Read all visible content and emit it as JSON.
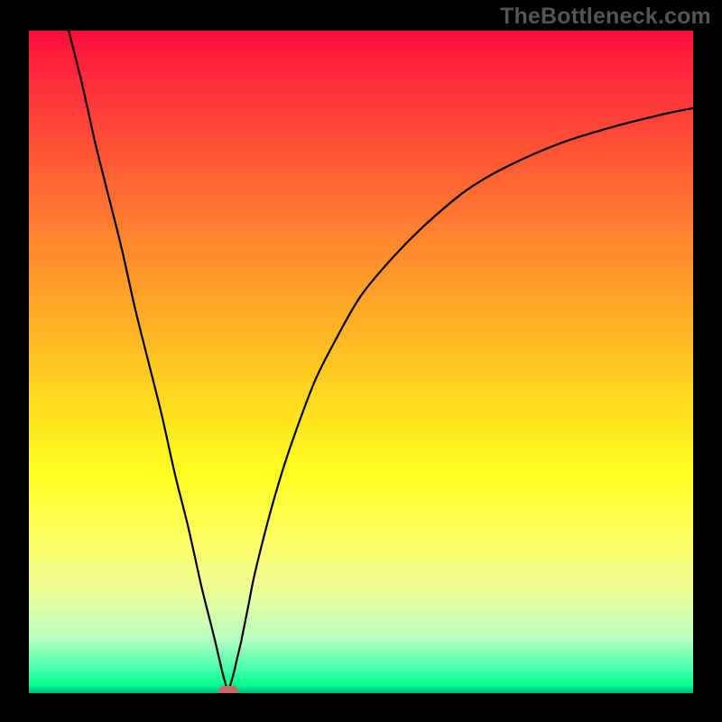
{
  "watermark": {
    "text": "TheBottleneck.com"
  },
  "chart_data": {
    "type": "line",
    "title": "",
    "xlabel": "",
    "ylabel": "",
    "x_range": [
      0,
      100
    ],
    "y_range": [
      0,
      100
    ],
    "minimum_marker": {
      "x": 30,
      "y": 0,
      "color": "#c26a63"
    },
    "series": [
      {
        "name": "curve",
        "x": [
          6,
          8,
          10,
          12,
          14,
          16,
          18,
          20,
          22,
          24,
          26,
          27,
          28,
          28.7,
          29.3,
          30,
          30.7,
          31.3,
          32,
          33,
          34,
          36,
          38,
          40,
          43,
          46,
          50,
          55,
          60,
          66,
          72,
          80,
          88,
          96,
          100
        ],
        "y": [
          100,
          92,
          83,
          75,
          67,
          58,
          50,
          42,
          33,
          25,
          16,
          12,
          8,
          5,
          2.5,
          0.6,
          2.5,
          5,
          8,
          13,
          18,
          26,
          33,
          39,
          47,
          53,
          60,
          66,
          71,
          76,
          79.5,
          83,
          85.5,
          87.5,
          88.3
        ]
      }
    ],
    "background_gradient": {
      "top": "#ff0d3d",
      "mid": "#ffe11e",
      "bottom": "#00b877"
    }
  }
}
